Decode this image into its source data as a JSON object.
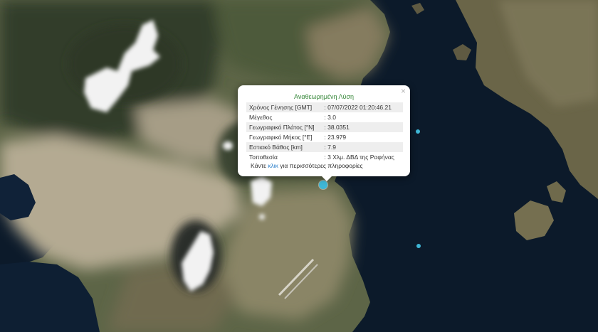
{
  "popup": {
    "title": "Αναθεωρημένη Λύση",
    "close_icon": "close-icon",
    "rows": [
      {
        "label": "Χρόνος Γένησης [GMT]",
        "sep": ":",
        "value": "07/07/2022 01:20:46.21"
      },
      {
        "label": "Μέγεθος",
        "sep": ":",
        "value": "3.0"
      },
      {
        "label": "Γεωγραφικό Πλάτος [°N]",
        "sep": ":",
        "value": "38.0351"
      },
      {
        "label": "Γεωγραφικό Μήκος [°E]",
        "sep": ":",
        "value": "23.979"
      },
      {
        "label": "Εστιακό Βάθος [km]",
        "sep": ":",
        "value": "7.9"
      },
      {
        "label": "Τοποθεσία",
        "sep": ":",
        "value": "3 Χλμ. ΔΒΔ της Ραφήνας"
      }
    ],
    "footer_prefix": "Κάντε ",
    "footer_link": "κλικ",
    "footer_suffix": " για περισσότερες πληροφορίες"
  },
  "colors": {
    "sea": "#0c1a2a",
    "land_dark": "#3c4631",
    "urban": "#b4aa92",
    "cloud": "#f2f2f2",
    "marker": "#3fb7d6",
    "title_green": "#3b8a3e",
    "link_blue": "#2a7ec9"
  }
}
